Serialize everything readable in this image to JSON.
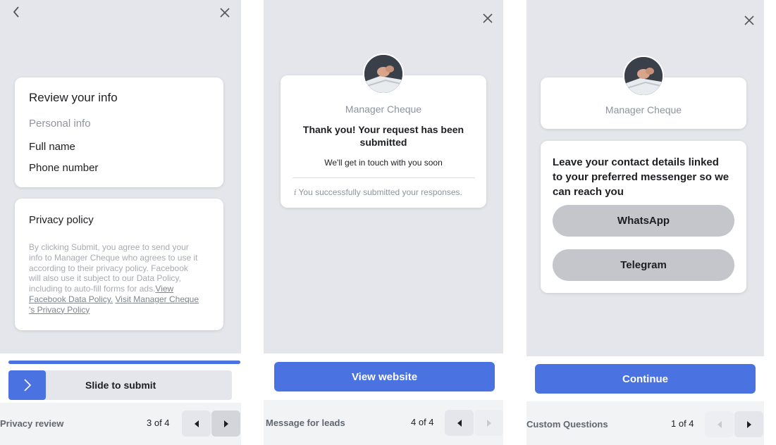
{
  "colors": {
    "screen_bg": "#e4e6eb",
    "card_bg": "#ffffff",
    "accent_blue": "#4a72e0",
    "pill_gray": "#c4c6cc",
    "footer_bg": "#f2f3f5",
    "muted_text": "#90949c"
  },
  "panels": [
    {
      "step_name": "Privacy review",
      "step_count": "3 of 4",
      "icons": [
        "chevron-left-icon",
        "close-icon",
        "chevron-right-icon",
        "caret-left-icon",
        "caret-right-icon"
      ],
      "review_card": {
        "title": "Review your info",
        "section": "Personal info",
        "fields": [
          "Full name",
          "Phone number"
        ]
      },
      "privacy_card": {
        "title": "Privacy policy",
        "body_lines": [
          "By clicking Submit, you agree to send your",
          "info to Manager Cheque who agrees to use it",
          "according to their privacy policy. Facebook",
          "will also use it subject to our Data Policy,"
        ],
        "body_last_plain": "including to auto-fill forms for ads.",
        "link_data_policy_a": "View",
        "link_data_policy_b": "Facebook Data Policy.",
        "link_visit_a": "Visit Manager Cheque",
        "link_visit_b": "'s Privacy Policy"
      },
      "slide_label": "Slide to submit",
      "progress": 1.0
    },
    {
      "step_name": "Message for leads",
      "step_count": "4 of 4",
      "icons": [
        "close-icon",
        "info-icon",
        "caret-left-icon",
        "caret-right-icon"
      ],
      "advertiser_name": "Manager Cheque",
      "heading_line1": "Thank you! Your request has been",
      "heading_line2": "submitted",
      "subtext": "We'll get in touch with you soon",
      "confirmation": "You successfully submitted your responses.",
      "cta_label": "View website"
    },
    {
      "step_name": "Custom Questions",
      "step_count": "1 of 4",
      "icons": [
        "close-icon",
        "caret-left-icon",
        "caret-right-icon"
      ],
      "advertiser_name": "Manager Cheque",
      "question_line1": "Leave your contact details linked",
      "question_line2": "to your preferred messenger so we",
      "question_line3": "can reach you",
      "options": [
        "WhatsApp",
        "Telegram"
      ],
      "cta_label": "Continue"
    }
  ]
}
